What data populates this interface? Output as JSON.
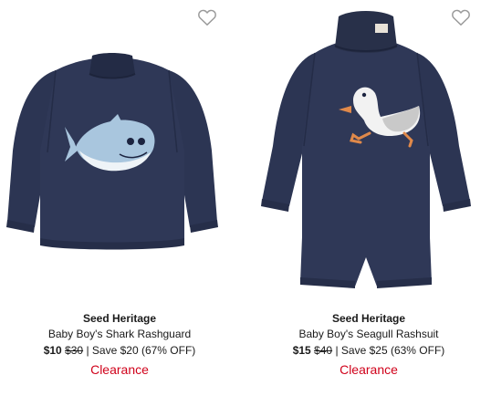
{
  "products": [
    {
      "brand": "Seed Heritage",
      "name": "Baby Boy's Shark Rashguard",
      "sale_price": "$10",
      "original_price": "$30",
      "separator": "|",
      "savings": "Save $20 (67% OFF)",
      "badge": "Clearance",
      "favorite_icon": "heart-outline-icon",
      "image_subject": "shark-rashguard-image"
    },
    {
      "brand": "Seed Heritage",
      "name": "Baby Boy's Seagull Rashsuit",
      "sale_price": "$15",
      "original_price": "$40",
      "separator": "|",
      "savings": "Save $25 (63% OFF)",
      "badge": "Clearance",
      "favorite_icon": "heart-outline-icon",
      "image_subject": "seagull-rashsuit-image"
    }
  ],
  "colors": {
    "garment_navy": "#2c3553",
    "badge_red": "#d0021b",
    "heart_outline": "#9a9a9a"
  }
}
